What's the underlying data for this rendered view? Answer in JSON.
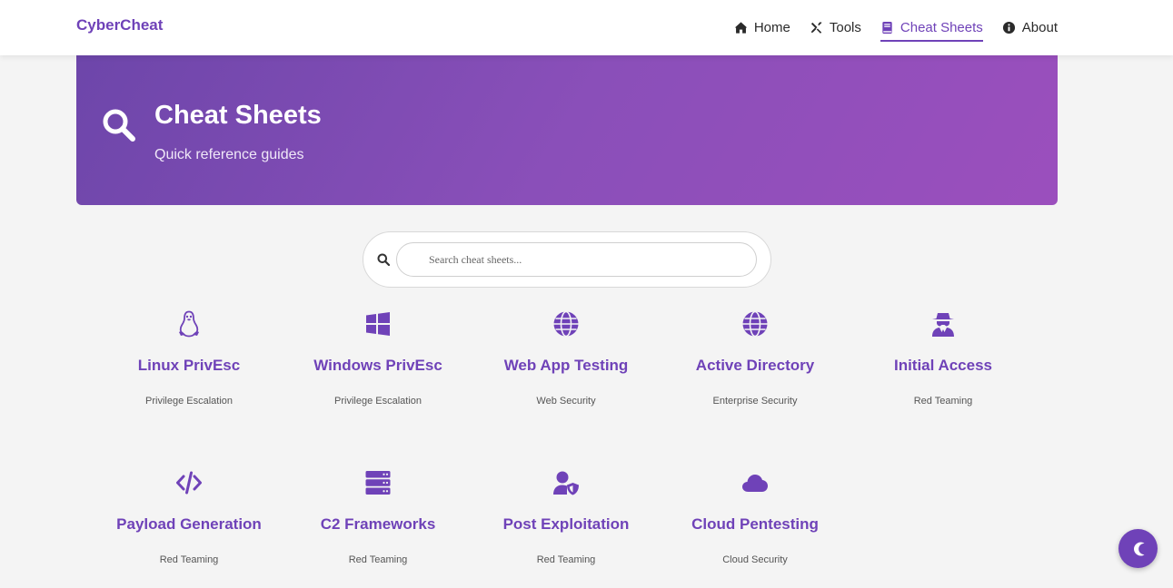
{
  "brand": "CyberCheat",
  "nav": {
    "items": [
      {
        "label": "Home",
        "icon": "home-icon"
      },
      {
        "label": "Tools",
        "icon": "tools-icon"
      },
      {
        "label": "Cheat Sheets",
        "icon": "book-icon",
        "active": true
      },
      {
        "label": "About",
        "icon": "info-icon"
      }
    ]
  },
  "hero": {
    "title": "Cheat Sheets",
    "subtitle": "Quick reference guides",
    "icon": "search-icon"
  },
  "search": {
    "placeholder": "Search cheat sheets...",
    "value": ""
  },
  "cards": [
    {
      "title": "Linux PrivEsc",
      "category": "Privilege Escalation",
      "icon": "linux-icon"
    },
    {
      "title": "Windows PrivEsc",
      "category": "Privilege Escalation",
      "icon": "windows-icon"
    },
    {
      "title": "Web App Testing",
      "category": "Web Security",
      "icon": "globe-icon"
    },
    {
      "title": "Active Directory",
      "category": "Enterprise Security",
      "icon": "globe-icon"
    },
    {
      "title": "Initial Access",
      "category": "Red Teaming",
      "icon": "spy-icon"
    },
    {
      "title": "Payload Generation",
      "category": "Red Teaming",
      "icon": "code-icon"
    },
    {
      "title": "C2 Frameworks",
      "category": "Red Teaming",
      "icon": "server-icon"
    },
    {
      "title": "Post Exploitation",
      "category": "Red Teaming",
      "icon": "user-shield-icon"
    },
    {
      "title": "Cloud Pentesting",
      "category": "Cloud Security",
      "icon": "cloud-icon"
    }
  ],
  "theme_toggle": {
    "icon": "moon-icon"
  },
  "colors": {
    "accent": "#6f42b8",
    "background": "#f4f4f4",
    "hero_start": "#6d46aa",
    "hero_end": "#9b4fbd"
  }
}
